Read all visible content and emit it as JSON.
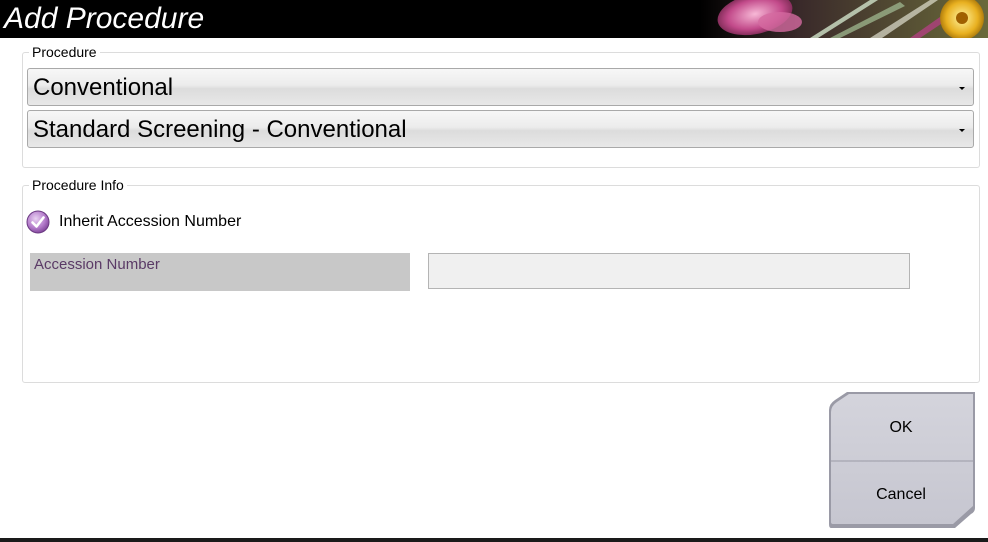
{
  "window": {
    "title": "Add Procedure"
  },
  "procedure_group": {
    "legend": "Procedure",
    "type_value": "Conventional",
    "procedure_value": "Standard Screening - Conventional"
  },
  "info_group": {
    "legend": "Procedure Info",
    "inherit_label": "Inherit Accession Number",
    "inherit_checked": true,
    "accession_label": "Accession Number",
    "accession_value": ""
  },
  "buttons": {
    "ok_label": "OK",
    "cancel_label": "Cancel"
  },
  "colors": {
    "title_bar": "#000000",
    "checkbox_accent": "#9a5fb0",
    "accession_label_text": "#5a3a66"
  }
}
